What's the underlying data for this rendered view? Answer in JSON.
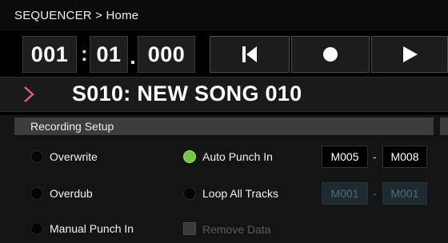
{
  "title_bar": {
    "text": "SEQUENCER > Home"
  },
  "locator": {
    "bar": "001",
    "beat": "01",
    "tick": "000",
    "sep": ":"
  },
  "transport": {
    "rewind_icon": "skip-to-start-icon",
    "record_icon": "record-icon",
    "play_icon": "play-icon"
  },
  "song": {
    "arrow_icon": "chevron-right-icon",
    "name": "S010: NEW SONG 010"
  },
  "recording_setup": {
    "title": "Recording Setup",
    "modes": [
      {
        "label": "Overwrite",
        "selected": false
      },
      {
        "label": "Overdub",
        "selected": false
      },
      {
        "label": "Manual Punch In",
        "selected": false
      }
    ],
    "punch": [
      {
        "label": "Auto Punch In",
        "selected": true
      },
      {
        "label": "Loop All Tracks",
        "selected": false
      }
    ],
    "remove_data": {
      "label": "Remove Data",
      "checked": false,
      "enabled": false
    },
    "auto_punch_range": {
      "start": "M005",
      "end": "M008",
      "dash": "-"
    },
    "loop_range": {
      "start": "M001",
      "end": "M001",
      "dash": "-"
    }
  },
  "colors": {
    "accent_green": "#7cc444",
    "song_arrow": "#e0606c"
  }
}
